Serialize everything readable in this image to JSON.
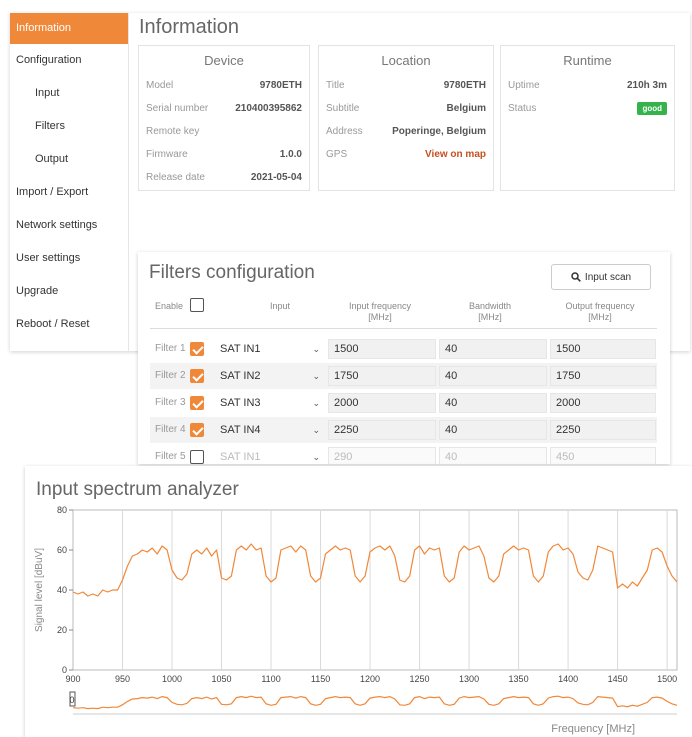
{
  "sidebar": {
    "items": [
      {
        "label": "Information",
        "active": true,
        "sub": false
      },
      {
        "label": "Configuration",
        "active": false,
        "sub": false
      },
      {
        "label": "Input",
        "active": false,
        "sub": true
      },
      {
        "label": "Filters",
        "active": false,
        "sub": true
      },
      {
        "label": "Output",
        "active": false,
        "sub": true
      },
      {
        "label": "Import / Export",
        "active": false,
        "sub": false
      },
      {
        "label": "Network settings",
        "active": false,
        "sub": false
      },
      {
        "label": "User settings",
        "active": false,
        "sub": false
      },
      {
        "label": "Upgrade",
        "active": false,
        "sub": false
      },
      {
        "label": "Reboot / Reset",
        "active": false,
        "sub": false
      }
    ]
  },
  "info": {
    "title": "Information",
    "device": {
      "heading": "Device",
      "rows": [
        {
          "key": "Model",
          "value": "9780ETH"
        },
        {
          "key": "Serial number",
          "value": "210400395862"
        },
        {
          "key": "Remote key",
          "value": ""
        },
        {
          "key": "Firmware",
          "value": "1.0.0"
        },
        {
          "key": "Release date",
          "value": "2021-05-04"
        }
      ]
    },
    "location": {
      "heading": "Location",
      "rows": [
        {
          "key": "Title",
          "value": "9780ETH"
        },
        {
          "key": "Subtitle",
          "value": "Belgium"
        },
        {
          "key": "Address",
          "value": "Poperinge, Belgium"
        },
        {
          "key": "GPS",
          "value": "View on map"
        }
      ]
    },
    "runtime": {
      "heading": "Runtime",
      "rows": [
        {
          "key": "Uptime",
          "value": "210h 3m"
        },
        {
          "key": "Status",
          "value": "good"
        }
      ]
    }
  },
  "filters": {
    "title": "Filters configuration",
    "scan_label": "Input scan",
    "headers": {
      "enable": "Enable",
      "input": "Input",
      "input_freq": "Input frequency",
      "input_freq_unit": "[MHz]",
      "bandwidth": "Bandwidth",
      "bandwidth_unit": "[MHz]",
      "output_freq": "Output frequency",
      "output_freq_unit": "[MHz]"
    },
    "rows": [
      {
        "label": "Filter 1",
        "enabled": true,
        "input": "SAT IN1",
        "input_freq": "1500",
        "bandwidth": "40",
        "output_freq": "1500"
      },
      {
        "label": "Filter 2",
        "enabled": true,
        "input": "SAT IN2",
        "input_freq": "1750",
        "bandwidth": "40",
        "output_freq": "1750"
      },
      {
        "label": "Filter 3",
        "enabled": true,
        "input": "SAT IN3",
        "input_freq": "2000",
        "bandwidth": "40",
        "output_freq": "2000"
      },
      {
        "label": "Filter 4",
        "enabled": true,
        "input": "SAT IN4",
        "input_freq": "2250",
        "bandwidth": "40",
        "output_freq": "2250"
      },
      {
        "label": "Filter 5",
        "enabled": false,
        "input": "SAT IN1",
        "input_freq": "290",
        "bandwidth": "40",
        "output_freq": "450"
      }
    ]
  },
  "spectrum": {
    "title": "Input spectrum analyzer",
    "colors": {
      "line": "#f0883a",
      "grid": "#d9d9d9",
      "axis": "#333333"
    }
  },
  "chart_data": {
    "type": "line",
    "title": "Input spectrum analyzer",
    "xlabel": "Frequency [MHz]",
    "ylabel": "Signal level [dBuV]",
    "xlim": [
      900,
      1510
    ],
    "ylim": [
      0,
      80
    ],
    "x_ticks": [
      "900",
      "950",
      "1000",
      "1050",
      "1100",
      "1150",
      "1200",
      "1250",
      "1300",
      "1350",
      "1400",
      "1450",
      "1500"
    ],
    "y_ticks": [
      "0",
      "20",
      "40",
      "60",
      "80"
    ],
    "grid": true,
    "navigator_label": "0",
    "series": [
      {
        "x": [
          900,
          905,
          910,
          915,
          920,
          925,
          930,
          935,
          940,
          945,
          950,
          955,
          960,
          965,
          970,
          975,
          980,
          985,
          990,
          995,
          1000,
          1005,
          1010,
          1015,
          1020,
          1025,
          1030,
          1035,
          1040,
          1045,
          1050,
          1055,
          1060,
          1065,
          1070,
          1075,
          1080,
          1085,
          1090,
          1095,
          1100,
          1105,
          1110,
          1115,
          1120,
          1125,
          1130,
          1135,
          1140,
          1145,
          1150,
          1155,
          1160,
          1165,
          1170,
          1175,
          1180,
          1185,
          1190,
          1195,
          1200,
          1205,
          1210,
          1215,
          1220,
          1225,
          1230,
          1235,
          1240,
          1245,
          1250,
          1255,
          1260,
          1265,
          1270,
          1275,
          1280,
          1285,
          1290,
          1295,
          1300,
          1305,
          1310,
          1315,
          1320,
          1325,
          1330,
          1335,
          1340,
          1345,
          1350,
          1355,
          1360,
          1365,
          1370,
          1375,
          1380,
          1385,
          1390,
          1395,
          1400,
          1405,
          1410,
          1415,
          1420,
          1425,
          1430,
          1435,
          1440,
          1445,
          1450,
          1455,
          1460,
          1465,
          1470,
          1475,
          1480,
          1485,
          1490,
          1495,
          1500,
          1505,
          1510
        ],
        "y": [
          39,
          38,
          39,
          37,
          38,
          37,
          40,
          39,
          40,
          40,
          45,
          52,
          57,
          58,
          60,
          59,
          61,
          58,
          62,
          60,
          50,
          46,
          45,
          48,
          58,
          60,
          58,
          61,
          57,
          60,
          46,
          45,
          47,
          60,
          62,
          60,
          63,
          60,
          61,
          47,
          44,
          46,
          60,
          61,
          62,
          59,
          62,
          60,
          47,
          44,
          46,
          58,
          60,
          62,
          60,
          61,
          60,
          47,
          44,
          47,
          59,
          61,
          62,
          60,
          62,
          57,
          45,
          44,
          47,
          60,
          62,
          58,
          61,
          60,
          61,
          47,
          44,
          46,
          59,
          62,
          60,
          61,
          62,
          57,
          46,
          44,
          47,
          58,
          60,
          62,
          60,
          61,
          60,
          47,
          44,
          47,
          59,
          62,
          63,
          60,
          61,
          58,
          49,
          46,
          45,
          50,
          62,
          61,
          60,
          59,
          41,
          43,
          41,
          44,
          42,
          46,
          50,
          60,
          61,
          59,
          52,
          47,
          44
        ]
      }
    ]
  }
}
